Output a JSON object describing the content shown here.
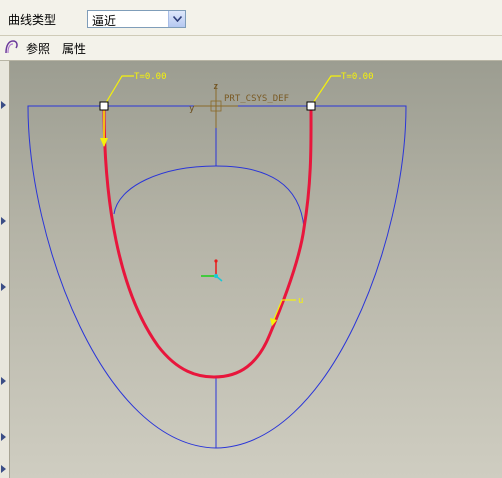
{
  "toolbar": {
    "curve_type_label": "曲线类型",
    "curve_type_value": "逼近"
  },
  "tabs": {
    "reference": "参照",
    "properties": "属性"
  },
  "viewport": {
    "csys_label": "PRT_CSYS_DEF",
    "start_param_label": "T=0.00",
    "end_param_label": "T=0.00",
    "direction_label": "u",
    "z_axis_label": "z",
    "y_axis_label": "y"
  },
  "colors": {
    "outline": "#2a35d8",
    "curve": "#e8163c",
    "annotation": "#f5f20a",
    "csys": "#8a6a2a"
  }
}
